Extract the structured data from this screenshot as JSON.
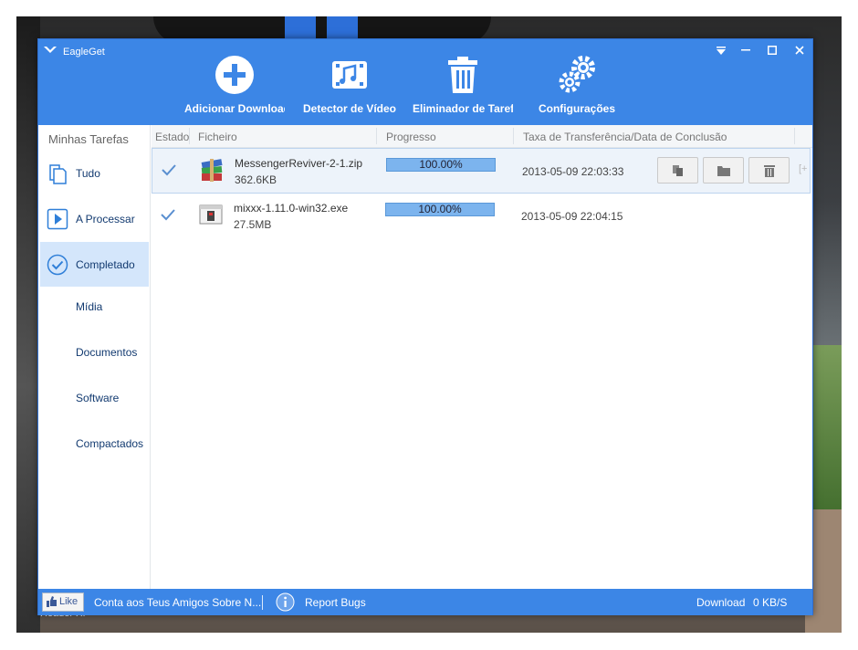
{
  "desktop": {
    "reader_label": "Reader XI"
  },
  "window": {
    "title": "EagleGet",
    "controls": [
      "menu",
      "minimize",
      "maximize",
      "close"
    ]
  },
  "toolbar": {
    "add_download": "Adicionar Download",
    "video_detector": "Detector de Vídeo",
    "task_eliminator": "Eliminador de Taref",
    "settings": "Configurações"
  },
  "sidebar": {
    "heading": "Minhas Tarefas",
    "items": [
      {
        "label": "Tudo",
        "icon": "documents-icon"
      },
      {
        "label": "A Processar",
        "icon": "play-icon"
      },
      {
        "label": "Completado",
        "icon": "check-circle-icon",
        "active": true
      },
      {
        "label": "Mídia"
      },
      {
        "label": "Documentos"
      },
      {
        "label": "Software"
      },
      {
        "label": "Compactados"
      }
    ]
  },
  "columns": {
    "status": "Estado",
    "file": "Ficheiro",
    "progress": "Progresso",
    "rate": "Taxa de Transferência/Data de Conclusão"
  },
  "rows": [
    {
      "name": "MessengerReviver-2-1.zip",
      "size": "362.6KB",
      "progress": "100.00%",
      "rate": "2013-05-09 22:03:33",
      "icon": "archive-icon",
      "selected": true
    },
    {
      "name": "mixxx-1.11.0-win32.exe",
      "size": "27.5MB",
      "progress": "100.00%",
      "rate": "2013-05-09 22:04:15",
      "icon": "installer-icon",
      "selected": false
    }
  ],
  "statusbar": {
    "like": "Like",
    "share": "Conta aos Teus Amigos Sobre N...",
    "report": "Report Bugs",
    "download_label": "Download",
    "speed": "0 KB/S"
  },
  "colors": {
    "accent": "#3c86e6",
    "active_item": "#d4e6fb",
    "progress_fill": "#7cb4ee"
  }
}
